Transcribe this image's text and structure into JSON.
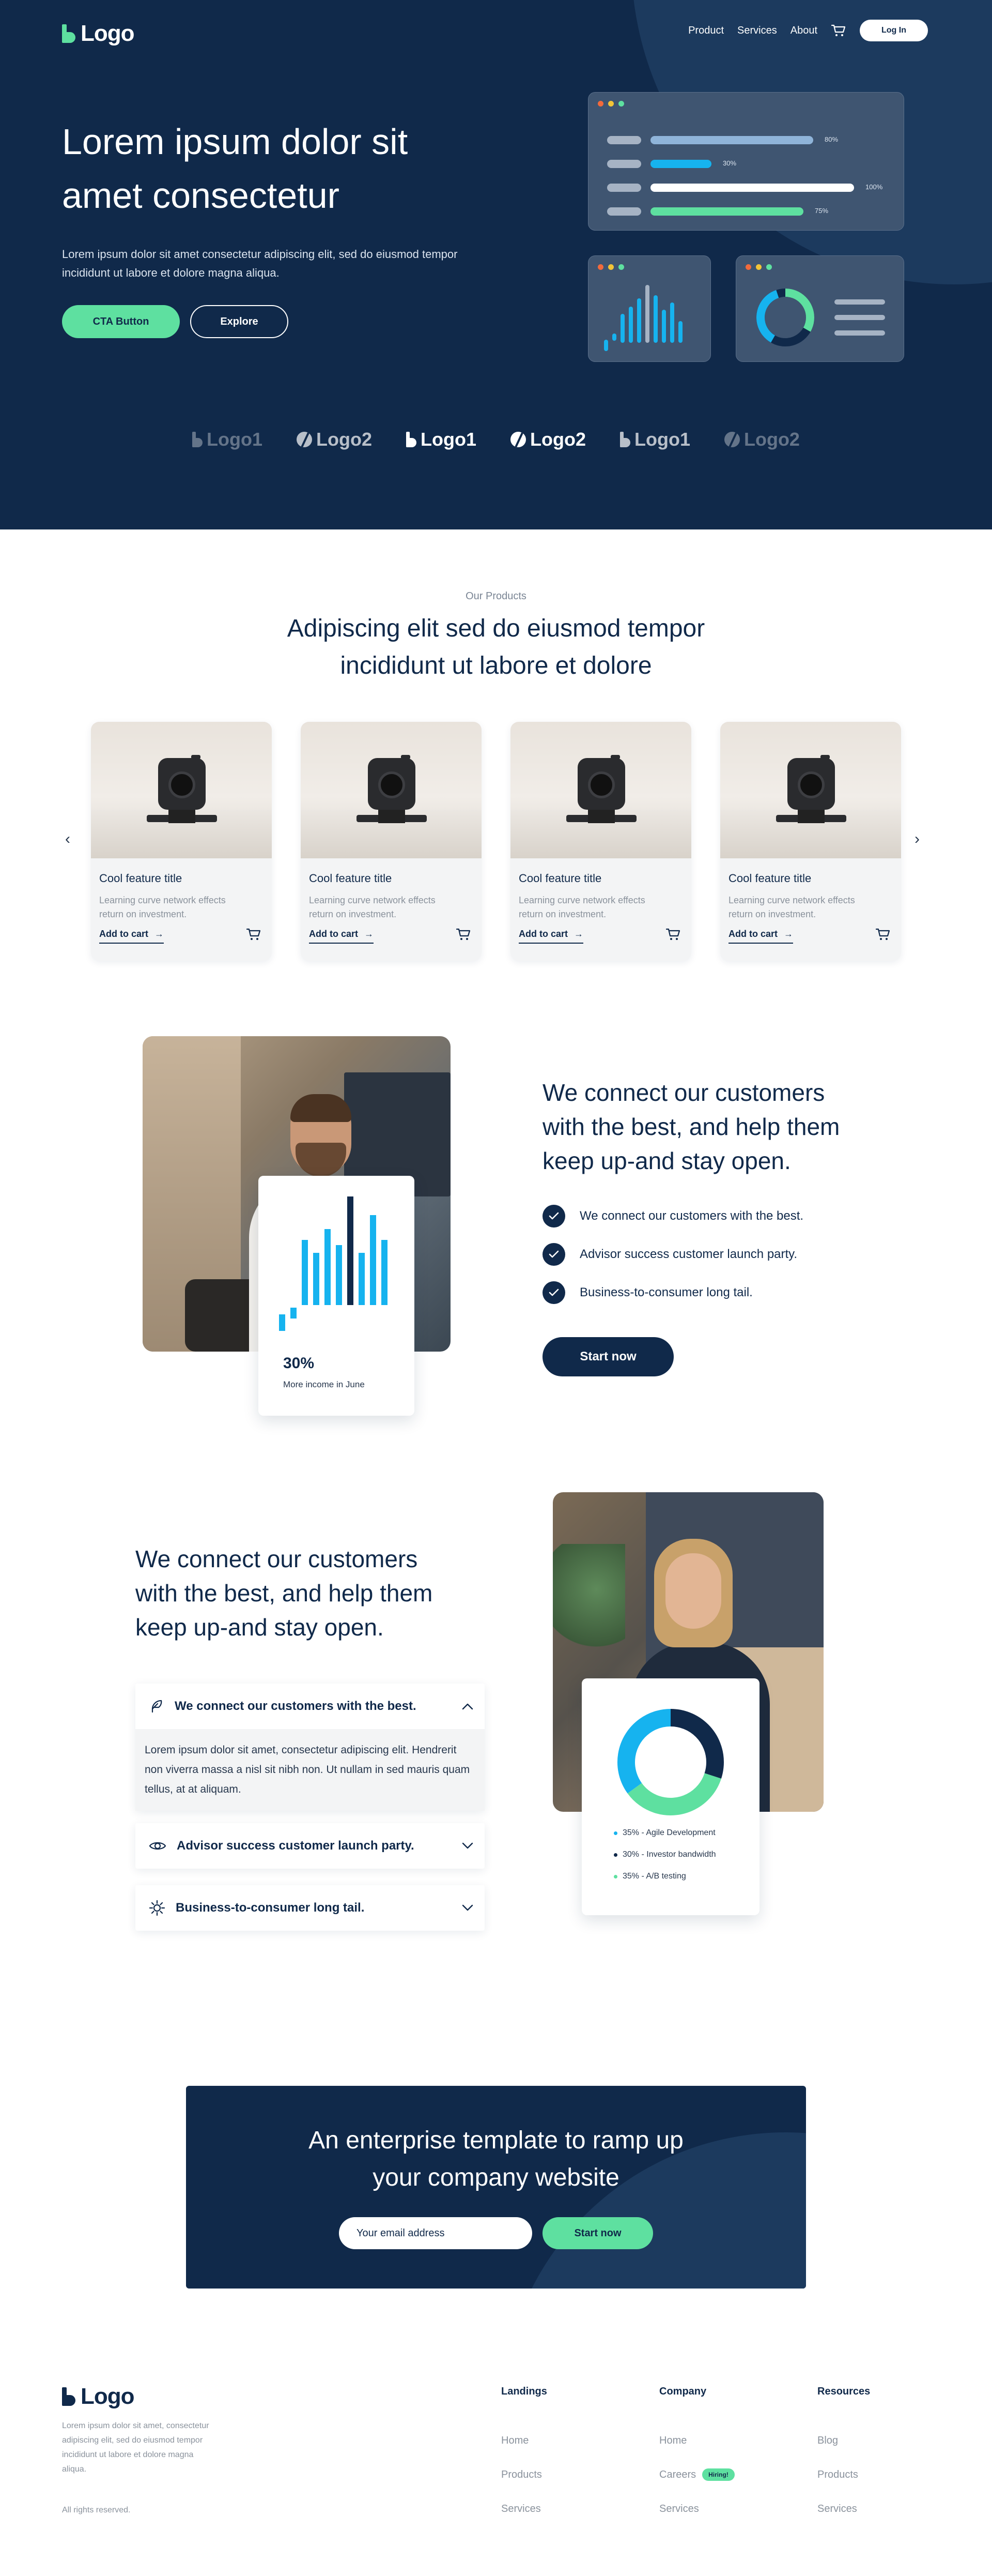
{
  "brand": {
    "logo_text": "Logo",
    "accent": "#5ee0a0",
    "navy": "#10294a"
  },
  "nav": {
    "items": [
      "Product",
      "Services",
      "About"
    ],
    "login": "Log In"
  },
  "hero": {
    "title": "Lorem ipsum dolor sit amet consectetur",
    "subtitle": "Lorem ipsum dolor sit amet consectetur adipiscing elit, sed do eiusmod tempor incididunt ut labore et dolore magna aliqua.",
    "cta_primary": "CTA Button",
    "cta_secondary": "Explore",
    "progress": [
      {
        "value": 80,
        "label": "80%",
        "color": "#8fb4d9"
      },
      {
        "value": 30,
        "label": "30%",
        "color": "#16b3ef"
      },
      {
        "value": 100,
        "label": "100%",
        "color": "#ffffff"
      },
      {
        "value": 75,
        "label": "75%",
        "color": "#5ee0a0"
      }
    ],
    "logos": [
      "Logo1",
      "Logo2",
      "Logo1",
      "Logo2",
      "Logo1",
      "Logo2"
    ]
  },
  "products": {
    "eyebrow": "Our Products",
    "title": "Adipiscing elit sed do eiusmod tempor incididunt ut labore et dolore",
    "items": [
      {
        "title": "Cool feature title",
        "desc": "Learning curve network effects return on investment.",
        "cta": "Add to cart"
      },
      {
        "title": "Cool feature title",
        "desc": "Learning curve network effects return on investment.",
        "cta": "Add to cart"
      },
      {
        "title": "Cool feature title",
        "desc": "Learning curve network effects return on investment.",
        "cta": "Add to cart"
      },
      {
        "title": "Cool feature title",
        "desc": "Learning curve network effects return on investment.",
        "cta": "Add to cart"
      }
    ]
  },
  "feature1": {
    "title": "We connect our customers with the best, and help them keep up-and stay open.",
    "checks": [
      "We connect our customers with the best.",
      "Advisor success customer launch party.",
      "Business-to-consumer long tail."
    ],
    "cta": "Start now",
    "stat_value": "30%",
    "stat_label": "More income in June",
    "bars": [
      0.15,
      0.1,
      0.6,
      0.48,
      0.7,
      0.55,
      1.0,
      0.48,
      0.83,
      0.6
    ]
  },
  "feature2": {
    "title": "We connect our customers with the best, and help them keep up-and stay open.",
    "accordion": [
      {
        "icon": "feather-icon",
        "title": "We connect our customers with the best.",
        "body": "Lorem ipsum dolor sit amet, consectetur adipiscing elit. Hendrerit non viverra massa a nisl sit nibh non. Ut nullam in sed mauris quam tellus, at at aliquam.",
        "open": true
      },
      {
        "icon": "eye-icon",
        "title": "Advisor success customer launch party.",
        "open": false
      },
      {
        "icon": "sun-icon",
        "title": "Business-to-consumer long tail.",
        "open": false
      }
    ],
    "donut": [
      {
        "label": "35% - Agile Development",
        "value": 35,
        "color": "#16b3ef"
      },
      {
        "label": "30% - Investor bandwidth",
        "value": 30,
        "color": "#10294a"
      },
      {
        "label": "35% - A/B testing",
        "value": 35,
        "color": "#5ee0a0"
      }
    ]
  },
  "cta": {
    "title": "An enterprise template to ramp up your company website",
    "email_placeholder": "Your email address",
    "button": "Start now"
  },
  "footer": {
    "desc": "Lorem ipsum dolor sit amet, consectetur adipiscing elit, sed do eiusmod tempor incididunt ut labore et dolore magna aliqua.",
    "rights": "All rights reserved.",
    "columns": [
      {
        "title": "Landings",
        "links": [
          "Home",
          "Products",
          "Services"
        ]
      },
      {
        "title": "Company",
        "links": [
          "Home",
          "Careers",
          "Services"
        ],
        "badge": "Hiring!"
      },
      {
        "title": "Resources",
        "links": [
          "Blog",
          "Products",
          "Services"
        ]
      }
    ]
  }
}
